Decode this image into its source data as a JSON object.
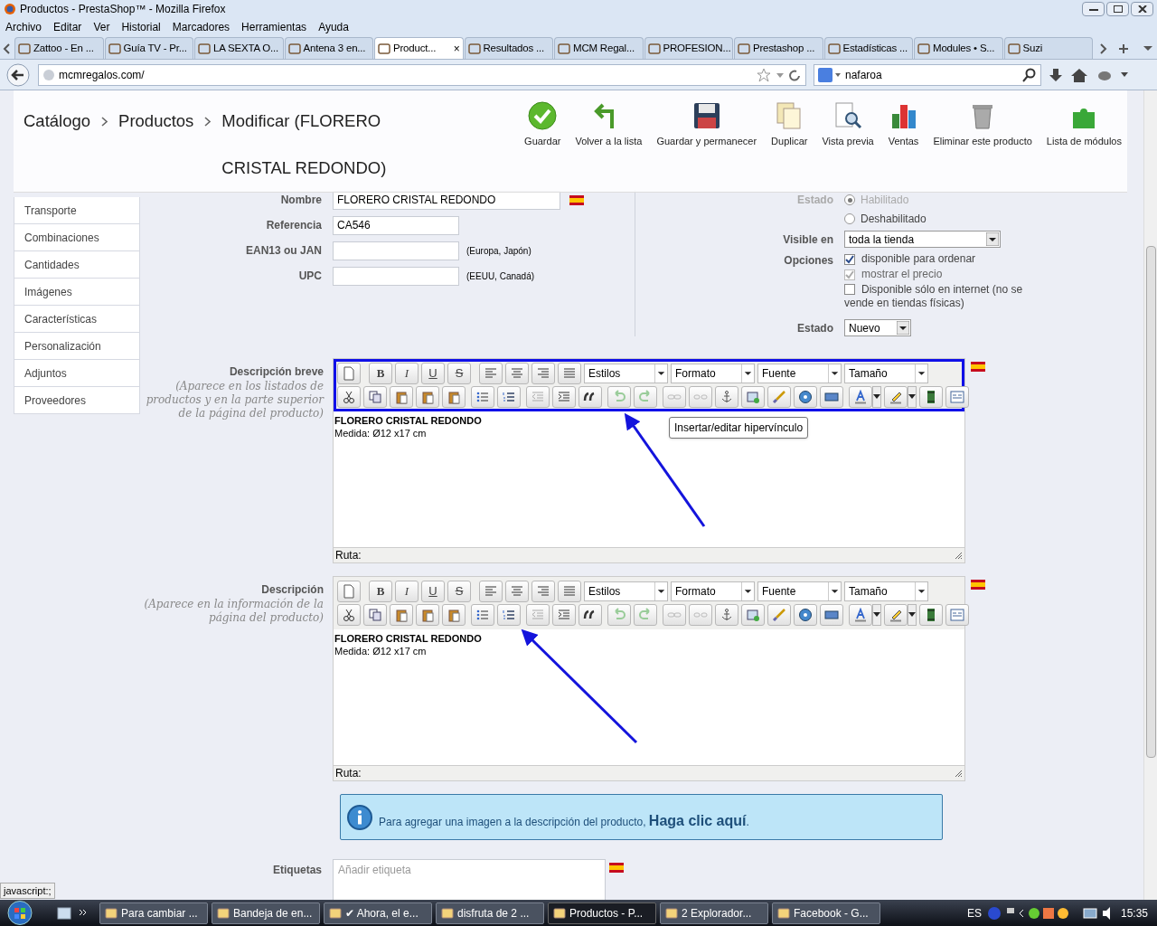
{
  "window": {
    "title": "Productos - PrestaShop™ - Mozilla Firefox"
  },
  "menu": [
    "Archivo",
    "Editar",
    "Ver",
    "Historial",
    "Marcadores",
    "Herramientas",
    "Ayuda"
  ],
  "tabs": [
    {
      "label": "Zattoo - En ...",
      "selected": false
    },
    {
      "label": "Guía TV - Pr...",
      "selected": false
    },
    {
      "label": "LA SEXTA O...",
      "selected": false
    },
    {
      "label": "Antena 3 en...",
      "selected": false
    },
    {
      "label": "Product...",
      "selected": true,
      "close": "×"
    },
    {
      "label": "Resultados ...",
      "selected": false
    },
    {
      "label": "MCM Regal...",
      "selected": false
    },
    {
      "label": "PROFESION...",
      "selected": false
    },
    {
      "label": "Prestashop ...",
      "selected": false
    },
    {
      "label": "Estadísticas ...",
      "selected": false
    },
    {
      "label": "Modules • S...",
      "selected": false
    },
    {
      "label": "Suzi",
      "selected": false
    }
  ],
  "address": "mcmregalos.com/",
  "search": "nafaroa",
  "breadcrumb": [
    "Catálogo",
    "Productos",
    "Modificar (FLORERO CRISTAL REDONDO)"
  ],
  "actions": [
    {
      "label": "Guardar",
      "kind": "check"
    },
    {
      "label": "Volver a la lista",
      "kind": "back"
    },
    {
      "label": "Guardar y permanecer",
      "kind": "disk"
    },
    {
      "label": "Duplicar",
      "kind": "copy"
    },
    {
      "label": "Vista previa",
      "kind": "preview"
    },
    {
      "label": "Ventas",
      "kind": "chart"
    },
    {
      "label": "Eliminar este producto",
      "kind": "trash"
    },
    {
      "label": "Lista de módulos",
      "kind": "puzzle"
    }
  ],
  "sidebar": [
    "Transporte",
    "Combinaciones",
    "Cantidades",
    "Imágenes",
    "Características",
    "Personalización",
    "Adjuntos",
    "Proveedores"
  ],
  "fields": [
    {
      "label": "Nombre",
      "value": "FLORERO CRISTAL REDONDO",
      "flag": true
    },
    {
      "label": "Referencia",
      "value": "CA546"
    },
    {
      "label": "EAN13 ou JAN",
      "note": "(Europa, Japón)"
    },
    {
      "label": "UPC",
      "note": "(EEUU, Canadá)"
    }
  ],
  "status": {
    "label": "Estado",
    "options": [
      {
        "label": "Habilitado",
        "selected": true,
        "faded": true
      },
      {
        "label": "Deshabilitado",
        "selected": false,
        "faded": false
      }
    ]
  },
  "visible": {
    "label": "Visible en",
    "value": "toda la tienda"
  },
  "options": {
    "label": "Opciones",
    "items": [
      {
        "label": "disponible para ordenar",
        "checked": true,
        "disabled": false
      },
      {
        "label": "mostrar el precio",
        "checked": true,
        "disabled": true
      },
      {
        "label": "Disponible sólo en internet (no se vende en tiendas físicas)",
        "checked": false,
        "disabled": false
      }
    ]
  },
  "condition": {
    "label": "Estado",
    "value": "Nuevo"
  },
  "editors": [
    {
      "label": "Descripción breve",
      "hint": "(Aparece en los listados de productos y en la parte superior de la página del producto)",
      "highlighted": true,
      "format_buttons": [
        "B",
        "I",
        "U",
        "S"
      ],
      "dropdowns": [
        "Estilos",
        "Formato",
        "Fuente",
        "Tamaño"
      ],
      "lines": [
        "FLORERO CRISTAL REDONDO",
        "Medida: Ø12 x17 cm"
      ],
      "path": "Ruta:",
      "tooltip": "Insertar/editar hipervínculo"
    },
    {
      "label": "Descripción",
      "hint": "(Aparece en la información de la página del producto)",
      "highlighted": false,
      "format_buttons": [
        "B",
        "I",
        "U",
        "S"
      ],
      "dropdowns": [
        "Estilos",
        "Formato",
        "Fuente",
        "Tamaño"
      ],
      "lines": [
        "FLORERO CRISTAL REDONDO",
        "Medida: Ø12 x17 cm"
      ],
      "path": "Ruta:"
    }
  ],
  "info": {
    "text": "Para agregar una imagen a la descripción del producto,",
    "link": "Haga clic aquí",
    "end": "."
  },
  "tags": {
    "label": "Etiquetas",
    "placeholder": "Añadir etiqueta"
  },
  "status_bar": "javascript:;",
  "taskbar": [
    {
      "label": "Para cambiar ...",
      "selected": false
    },
    {
      "label": "Bandeja de en...",
      "selected": false
    },
    {
      "label": "✔ Ahora, el e...",
      "selected": false
    },
    {
      "label": "disfruta de 2 ...",
      "selected": false
    },
    {
      "label": "Productos - P...",
      "selected": true
    },
    {
      "label": "2 Explorador...",
      "selected": false
    },
    {
      "label": "Facebook - G...",
      "selected": false
    }
  ],
  "tray": {
    "lang": "ES",
    "clock": "15:35"
  }
}
